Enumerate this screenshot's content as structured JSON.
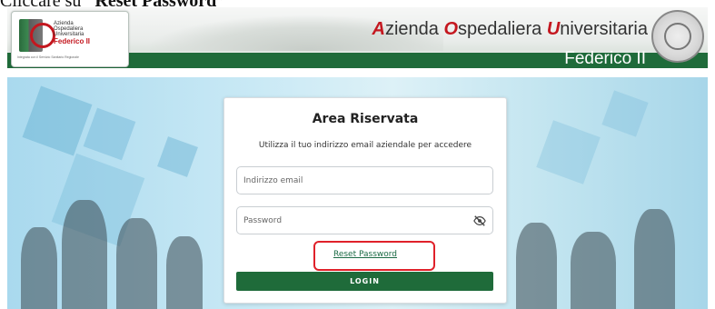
{
  "caption": {
    "prefix": "Cliccare su ",
    "emph": "“Reset Password”"
  },
  "header": {
    "logo_lines": [
      "Azienda",
      "Ospedaliera",
      "Universitaria"
    ],
    "logo_name": "Federico II",
    "logo_footer": "Integrata con il Servizio Sanitario Regionale",
    "org_name": "Azienda Ospedaliera Universitaria",
    "org_sub": "Federico II"
  },
  "login": {
    "title": "Area Riservata",
    "subtitle": "Utilizza il tuo indirizzo email aziendale per accedere",
    "email_placeholder": "Indirizzo email",
    "email_value": "",
    "password_placeholder": "Password",
    "password_value": "",
    "reset_label": "Reset Password",
    "login_label": "LOGIN"
  },
  "colors": {
    "brand_green": "#1f6b3a",
    "accent_red": "#c4171f",
    "highlight": "#e0212a",
    "link": "#1b6b45"
  },
  "icons": {
    "password_toggle": "eye-slash-icon"
  }
}
